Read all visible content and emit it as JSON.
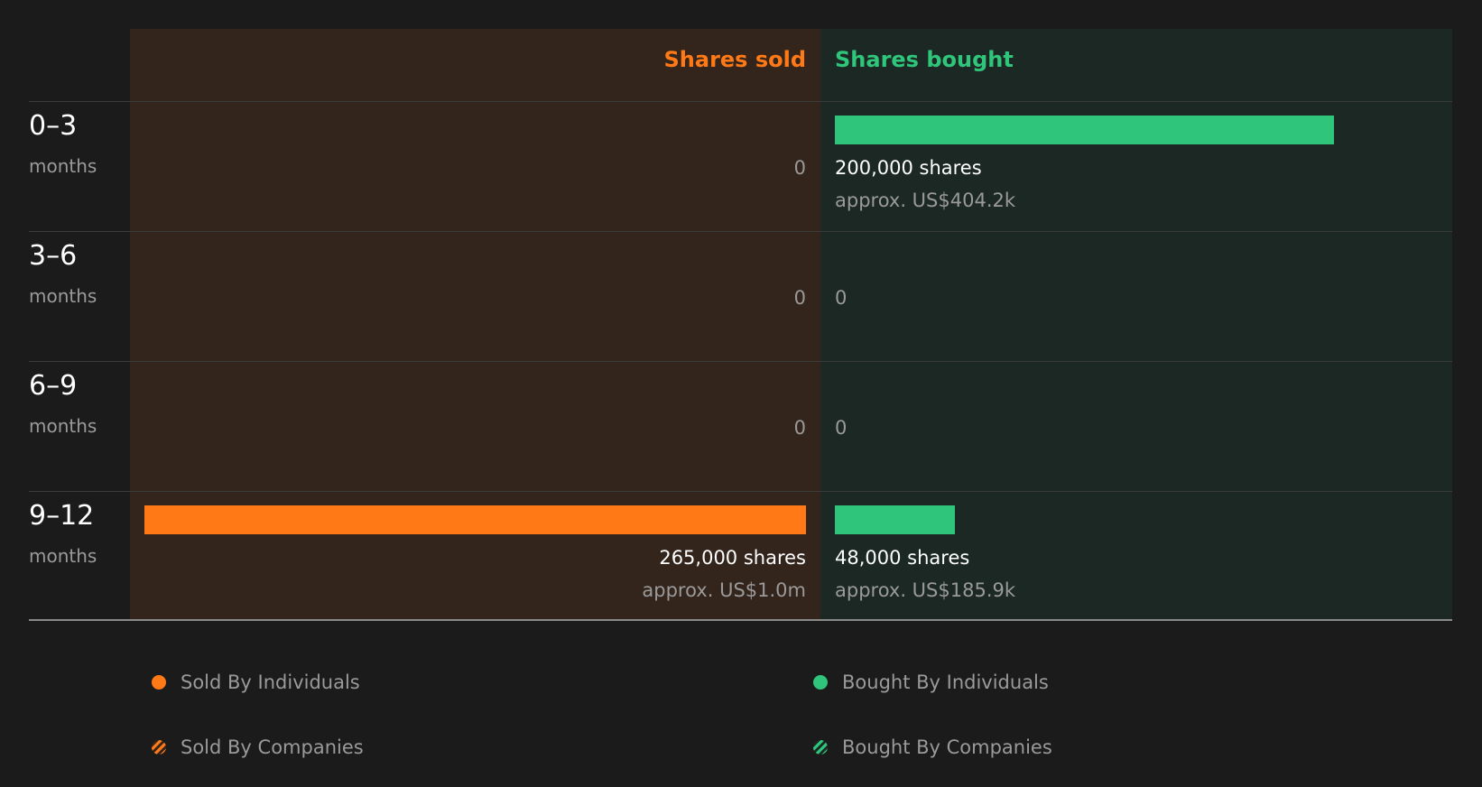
{
  "colors": {
    "sold": "#ff7a17",
    "bought": "#2fc67c",
    "sold_bg": "#33241c",
    "bought_bg": "#1c2823",
    "background": "#1b1b1b"
  },
  "headers": {
    "sold": "Shares sold",
    "bought": "Shares bought"
  },
  "chart_data": {
    "type": "bar",
    "categories": [
      "0-3",
      "3-6",
      "6-9",
      "9-12"
    ],
    "category_unit": "months",
    "xlim": [
      0,
      265000
    ],
    "series": [
      {
        "name": "Shares sold",
        "values": [
          0,
          0,
          0,
          265000
        ]
      },
      {
        "name": "Shares bought",
        "values": [
          200000,
          0,
          0,
          48000
        ]
      }
    ]
  },
  "rows": [
    {
      "period": "0–3",
      "unit": "months",
      "sold": {
        "label": "0",
        "approx": ""
      },
      "bought": {
        "label": "200,000 shares",
        "approx": "approx. US$404.2k"
      }
    },
    {
      "period": "3–6",
      "unit": "months",
      "sold": {
        "label": "0",
        "approx": ""
      },
      "bought": {
        "label": "0",
        "approx": ""
      }
    },
    {
      "period": "6–9",
      "unit": "months",
      "sold": {
        "label": "0",
        "approx": ""
      },
      "bought": {
        "label": "0",
        "approx": ""
      }
    },
    {
      "period": "9–12",
      "unit": "months",
      "sold": {
        "label": "265,000 shares",
        "approx": "approx. US$1.0m"
      },
      "bought": {
        "label": "48,000 shares",
        "approx": "approx. US$185.9k"
      }
    }
  ],
  "legend": [
    {
      "label": "Sold By Individuals",
      "icon": "orange-dot-icon"
    },
    {
      "label": "Bought By Individuals",
      "icon": "green-dot-icon"
    },
    {
      "label": "Sold By Companies",
      "icon": "orange-hatched-dot-icon"
    },
    {
      "label": "Bought By Companies",
      "icon": "green-hatched-dot-icon"
    }
  ]
}
